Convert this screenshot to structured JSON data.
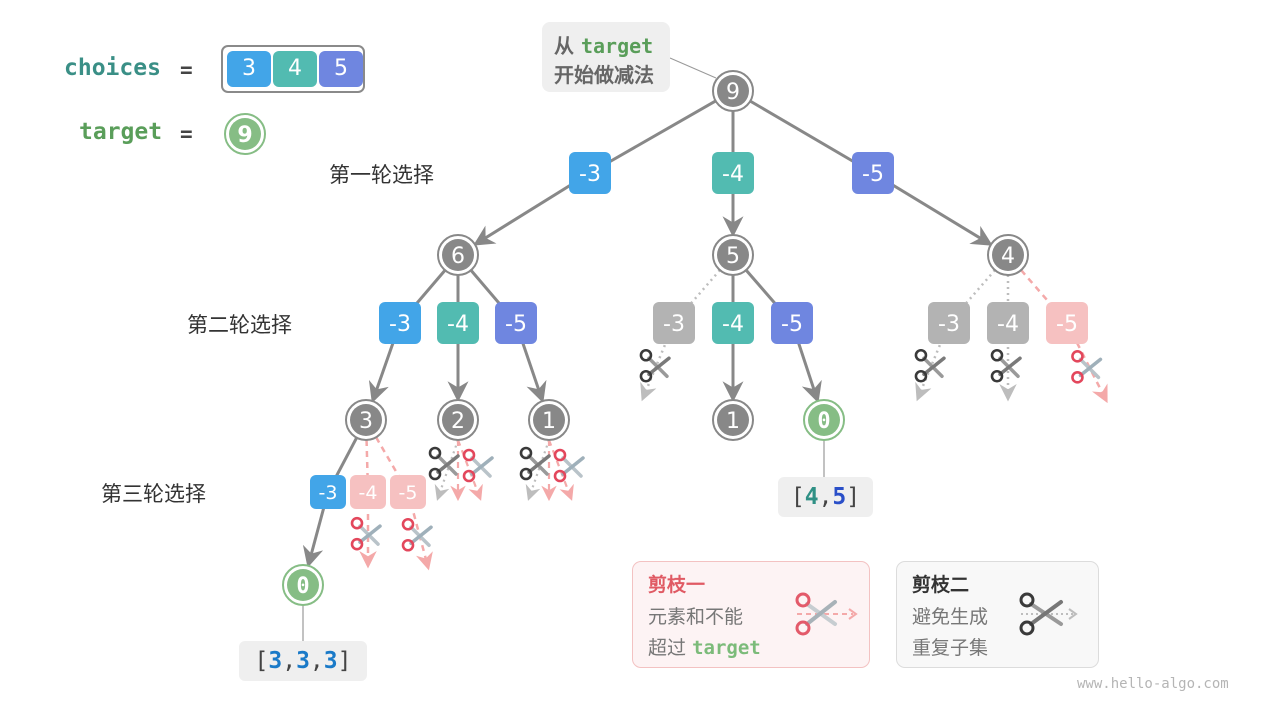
{
  "header": {
    "choices_label": "choices",
    "target_label": "target",
    "equals": "=",
    "choices": [
      "3",
      "4",
      "5"
    ],
    "target_value": "9"
  },
  "callout": {
    "line1_prefix": "从",
    "line1_code": "target",
    "line2": "开始做减法"
  },
  "rounds": [
    "第一轮选择",
    "第二轮选择",
    "第三轮选择"
  ],
  "colors": {
    "choice3": "#42a5e8",
    "choice4": "#52bbb1",
    "choice5": "#6f86e0",
    "node": "#888888",
    "goal": "#86bd85",
    "pruned_gray": "#b3b3b3",
    "pruned_pink": "#f6c1c1",
    "red": "#e3475c"
  },
  "tree": {
    "nodes": [
      {
        "id": "n9",
        "value": "9",
        "type": "node"
      },
      {
        "id": "n6",
        "value": "6",
        "type": "node"
      },
      {
        "id": "n5",
        "value": "5",
        "type": "node"
      },
      {
        "id": "n4",
        "value": "4",
        "type": "node"
      },
      {
        "id": "n3",
        "value": "3",
        "type": "node"
      },
      {
        "id": "n2",
        "value": "2",
        "type": "node"
      },
      {
        "id": "n1a",
        "value": "1",
        "type": "node"
      },
      {
        "id": "n1b",
        "value": "1",
        "type": "node"
      },
      {
        "id": "n0b",
        "value": "0",
        "type": "goal"
      },
      {
        "id": "n0a",
        "value": "0",
        "type": "goal"
      }
    ],
    "edges": [
      {
        "from": "n9",
        "label": "-3",
        "choice": 3,
        "to": "n6",
        "state": "taken"
      },
      {
        "from": "n9",
        "label": "-4",
        "choice": 4,
        "to": "n5",
        "state": "taken"
      },
      {
        "from": "n9",
        "label": "-5",
        "choice": 5,
        "to": "n4",
        "state": "taken"
      },
      {
        "from": "n6",
        "label": "-3",
        "choice": 3,
        "to": "n3",
        "state": "taken"
      },
      {
        "from": "n6",
        "label": "-4",
        "choice": 4,
        "to": "n2",
        "state": "taken"
      },
      {
        "from": "n6",
        "label": "-5",
        "choice": 5,
        "to": "n1a",
        "state": "taken"
      },
      {
        "from": "n5",
        "label": "-3",
        "choice": 3,
        "state": "pruned-duplicate"
      },
      {
        "from": "n5",
        "label": "-4",
        "choice": 4,
        "to": "n1b",
        "state": "taken"
      },
      {
        "from": "n5",
        "label": "-5",
        "choice": 5,
        "to": "n0b",
        "state": "taken"
      },
      {
        "from": "n4",
        "label": "-3",
        "choice": 3,
        "state": "pruned-duplicate"
      },
      {
        "from": "n4",
        "label": "-4",
        "choice": 4,
        "state": "pruned-duplicate"
      },
      {
        "from": "n4",
        "label": "-5",
        "choice": 5,
        "state": "pruned-exceed"
      },
      {
        "from": "n3",
        "label": "-3",
        "choice": 3,
        "to": "n0a",
        "state": "taken"
      },
      {
        "from": "n3",
        "label": "-4",
        "choice": 4,
        "state": "pruned-exceed"
      },
      {
        "from": "n3",
        "label": "-5",
        "choice": 5,
        "state": "pruned-exceed"
      }
    ],
    "results": [
      {
        "node": "n0a",
        "items": [
          "3",
          "3",
          "3"
        ]
      },
      {
        "node": "n0b",
        "items": [
          "4",
          "5"
        ]
      }
    ]
  },
  "legend": {
    "prune1": {
      "title": "剪枝一",
      "line1": "元素和不能",
      "line2_prefix": "超过",
      "line2_code": "target"
    },
    "prune2": {
      "title": "剪枝二",
      "line1": "避免生成",
      "line2": "重复子集"
    }
  },
  "watermark": "www.hello-algo.com"
}
